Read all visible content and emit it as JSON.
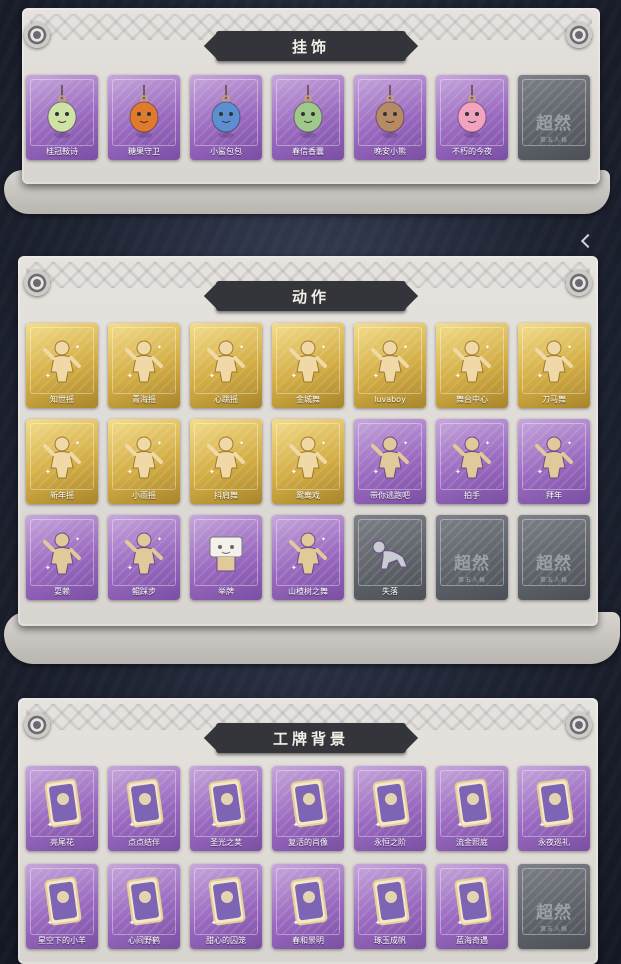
{
  "sections": {
    "ornaments": {
      "title": "挂饰",
      "items": [
        {
          "label": "桂冠鞍诗",
          "rarity": "purple",
          "icon": "fairy-doll-charm"
        },
        {
          "label": "糖果守卫",
          "rarity": "purple",
          "icon": "pumpkin-scarecrow-charm"
        },
        {
          "label": "小鲨包包",
          "rarity": "purple",
          "icon": "shark-bag-charm"
        },
        {
          "label": "春信香囊",
          "rarity": "purple",
          "icon": "sachet-charm"
        },
        {
          "label": "晚安小熊",
          "rarity": "purple",
          "icon": "bear-charm"
        },
        {
          "label": "不朽的今夜",
          "rarity": "purple",
          "icon": "pink-cat-charm"
        },
        {
          "label": "",
          "rarity": "locked",
          "icon": "locked-placeholder",
          "placeholder": "超然",
          "placeholder_sub": "第五人格"
        }
      ]
    },
    "actions": {
      "title": "动作",
      "items": [
        {
          "label": "知世摇",
          "rarity": "gold",
          "icon": "emote-pose-icon"
        },
        {
          "label": "青海摇",
          "rarity": "gold",
          "icon": "emote-pose-icon"
        },
        {
          "label": "心跳摇",
          "rarity": "gold",
          "icon": "emote-pose-icon"
        },
        {
          "label": "金城舞",
          "rarity": "gold",
          "icon": "emote-pose-icon"
        },
        {
          "label": "luvaboy",
          "rarity": "gold",
          "icon": "emote-pose-icon"
        },
        {
          "label": "舞台中心",
          "rarity": "gold",
          "icon": "emote-pose-icon"
        },
        {
          "label": "刀马舞",
          "rarity": "gold",
          "icon": "emote-pose-icon"
        },
        {
          "label": "新年摇",
          "rarity": "gold",
          "icon": "emote-pose-icon"
        },
        {
          "label": "小雨摇",
          "rarity": "gold",
          "icon": "emote-pose-icon"
        },
        {
          "label": "抖肩舞",
          "rarity": "gold",
          "icon": "emote-pose-icon"
        },
        {
          "label": "鸳鸯戏",
          "rarity": "gold",
          "icon": "emote-pose-icon"
        },
        {
          "label": "带你逃跑吧",
          "rarity": "purple",
          "icon": "emote-pose-icon"
        },
        {
          "label": "拍手",
          "rarity": "purple",
          "icon": "emote-pose-icon"
        },
        {
          "label": "拜年",
          "rarity": "purple",
          "icon": "emote-pose-icon"
        },
        {
          "label": "耍赖",
          "rarity": "purple",
          "icon": "emote-pose-icon"
        },
        {
          "label": "鲲踩步",
          "rarity": "purple",
          "icon": "emote-pose-icon"
        },
        {
          "label": "举牌",
          "rarity": "purple",
          "icon": "emote-sign-icon"
        },
        {
          "label": "山楂树之舞",
          "rarity": "purple",
          "icon": "emote-pose-icon"
        },
        {
          "label": "失落",
          "rarity": "gray",
          "icon": "emote-crawl-icon"
        },
        {
          "label": "",
          "rarity": "locked",
          "icon": "locked-placeholder",
          "placeholder": "超然",
          "placeholder_sub": "第五人格"
        },
        {
          "label": "",
          "rarity": "locked",
          "icon": "locked-placeholder",
          "placeholder": "超然",
          "placeholder_sub": "第五人格"
        }
      ]
    },
    "badge_backgrounds": {
      "title": "工牌背景",
      "items": [
        {
          "label": "亮尾花",
          "rarity": "purple",
          "icon": "badge-card-icon"
        },
        {
          "label": "点点结伴",
          "rarity": "purple",
          "icon": "badge-card-icon"
        },
        {
          "label": "圣光之荚",
          "rarity": "purple",
          "icon": "badge-card-icon"
        },
        {
          "label": "复活的肖像",
          "rarity": "purple",
          "icon": "badge-card-icon"
        },
        {
          "label": "永恒之阶",
          "rarity": "purple",
          "icon": "badge-card-icon"
        },
        {
          "label": "流金照庭",
          "rarity": "purple",
          "icon": "badge-card-icon"
        },
        {
          "label": "永夜巡礼",
          "rarity": "purple",
          "icon": "badge-card-icon"
        },
        {
          "label": "星空下的小羊",
          "rarity": "purple",
          "icon": "badge-card-icon"
        },
        {
          "label": "心间野鹤",
          "rarity": "purple",
          "icon": "badge-card-icon"
        },
        {
          "label": "甜心的囚笼",
          "rarity": "purple",
          "icon": "badge-card-icon"
        },
        {
          "label": "春和景明",
          "rarity": "purple",
          "icon": "badge-card-icon"
        },
        {
          "label": "琢玉成帆",
          "rarity": "purple",
          "icon": "badge-card-icon"
        },
        {
          "label": "蓝海奇遇",
          "rarity": "purple",
          "icon": "badge-card-icon"
        },
        {
          "label": "",
          "rarity": "locked",
          "icon": "locked-placeholder",
          "placeholder": "超然",
          "placeholder_sub": "第五人格"
        }
      ]
    }
  },
  "colors": {
    "gold": "#d4ae45",
    "purple": "#9a6ac0",
    "gray": "#5d6168",
    "banner": "#34353a",
    "panel": "#e6e3df"
  }
}
